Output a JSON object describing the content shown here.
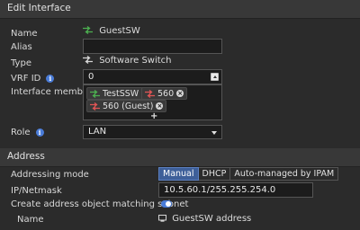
{
  "edit_section": {
    "title": "Edit Interface"
  },
  "labels": {
    "name": "Name",
    "alias": "Alias",
    "type": "Type",
    "vrf_id": "VRF ID",
    "interface_members": "Interface members",
    "role": "Role"
  },
  "name_value": "GuestSW",
  "type_value": "Software Switch",
  "vrf_value": "0",
  "members": [
    {
      "label": "TestSSW",
      "icon": "wifi-ssid-icon",
      "color": "#4caf50"
    },
    {
      "label": "560",
      "icon": "vlan-icon",
      "color": "#e05555"
    },
    {
      "label": "560 (Guest)",
      "icon": "vlan-icon",
      "color": "#e05555"
    }
  ],
  "add_symbol": "+",
  "role_value": "LAN",
  "address_section": {
    "title": "Address"
  },
  "address_labels": {
    "addressing_mode": "Addressing mode",
    "ip_netmask": "IP/Netmask",
    "create_object": "Create address object matching subnet",
    "name": "Name"
  },
  "addressing_modes": [
    "Manual",
    "DHCP",
    "Auto-managed by IPAM"
  ],
  "ip_value": "10.5.60.1/255.255.254.0",
  "address_name_value": "GuestSW address",
  "colors": {
    "accent": "#4a7cd8",
    "background": "#2b2b2b",
    "header": "#383838"
  }
}
